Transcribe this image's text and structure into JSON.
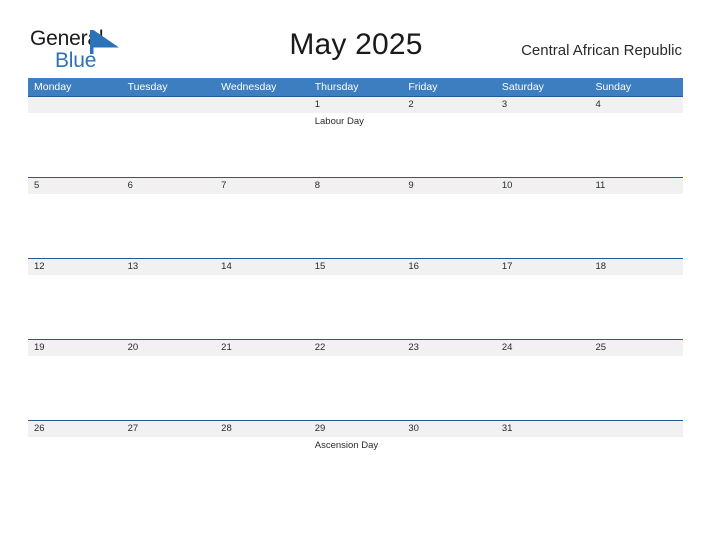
{
  "branding": {
    "logo_text_primary": "General",
    "logo_text_secondary": "Blue",
    "logo_flag_icon": "blue-flag-triangle-icon",
    "primary_color": "#2b72b8",
    "header_color": "#3c7ebf",
    "rule_color": "#1f5c96",
    "date_band_color": "#f1f1f1"
  },
  "header": {
    "title": "May 2025",
    "country": "Central African Republic"
  },
  "calendar": {
    "weekdays": [
      "Monday",
      "Tuesday",
      "Wednesday",
      "Thursday",
      "Friday",
      "Saturday",
      "Sunday"
    ],
    "weeks": [
      {
        "dates": [
          "",
          "",
          "",
          "1",
          "2",
          "3",
          "4"
        ],
        "events": [
          "",
          "",
          "",
          "Labour Day",
          "",
          "",
          ""
        ]
      },
      {
        "dates": [
          "5",
          "6",
          "7",
          "8",
          "9",
          "10",
          "11"
        ],
        "events": [
          "",
          "",
          "",
          "",
          "",
          "",
          ""
        ]
      },
      {
        "dates": [
          "12",
          "13",
          "14",
          "15",
          "16",
          "17",
          "18"
        ],
        "events": [
          "",
          "",
          "",
          "",
          "",
          "",
          ""
        ]
      },
      {
        "dates": [
          "19",
          "20",
          "21",
          "22",
          "23",
          "24",
          "25"
        ],
        "events": [
          "",
          "",
          "",
          "",
          "",
          "",
          ""
        ]
      },
      {
        "dates": [
          "26",
          "27",
          "28",
          "29",
          "30",
          "31",
          ""
        ],
        "events": [
          "",
          "",
          "",
          "Ascension Day",
          "",
          "",
          ""
        ]
      }
    ]
  }
}
